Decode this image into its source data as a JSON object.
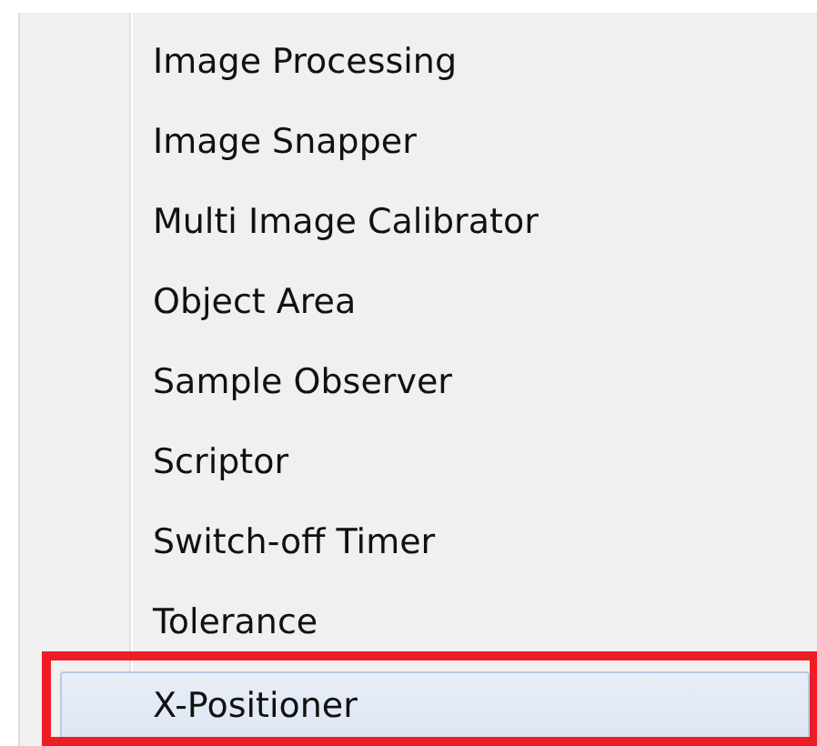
{
  "menu": {
    "items": [
      {
        "label": "Image Processing",
        "selected": false
      },
      {
        "label": "Image Snapper",
        "selected": false
      },
      {
        "label": "Multi Image Calibrator",
        "selected": false
      },
      {
        "label": "Object Area",
        "selected": false
      },
      {
        "label": "Sample Observer",
        "selected": false
      },
      {
        "label": "Scriptor",
        "selected": false
      },
      {
        "label": "Switch-off Timer",
        "selected": false
      },
      {
        "label": "Tolerance",
        "selected": false
      },
      {
        "label": "X-Positioner",
        "selected": true
      }
    ]
  }
}
